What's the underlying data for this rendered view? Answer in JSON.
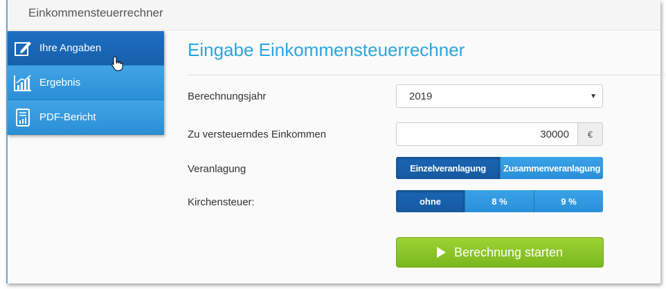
{
  "app": {
    "title": "Einkommensteuerrechner"
  },
  "sidebar": {
    "items": [
      {
        "label": "Ihre Angaben",
        "icon": "edit-icon",
        "active": true
      },
      {
        "label": "Ergebnis",
        "icon": "bar-chart-icon",
        "active": false
      },
      {
        "label": "PDF-Bericht",
        "icon": "report-icon",
        "active": false
      }
    ]
  },
  "form": {
    "heading": "Eingabe Einkommensteuerrechner",
    "year": {
      "label": "Berechnungsjahr",
      "value": "2019"
    },
    "income": {
      "label": "Zu versteuerndes Einkommen",
      "value": "30000",
      "unit": "€"
    },
    "assessment": {
      "label": "Veranlagung",
      "options": [
        "Einzelveranlagung",
        "Zusammenveranlagung"
      ],
      "selected": "Einzelveranlagung"
    },
    "church_tax": {
      "label": "Kirchensteuer:",
      "options": [
        "ohne",
        "8 %",
        "9 %"
      ],
      "selected": "ohne"
    },
    "submit_label": "Berechnung starten"
  },
  "colors": {
    "accent": "#2aa5e0",
    "nav_active": "#1760ac",
    "nav": "#2b8fd6",
    "submit": "#8cc42a"
  }
}
